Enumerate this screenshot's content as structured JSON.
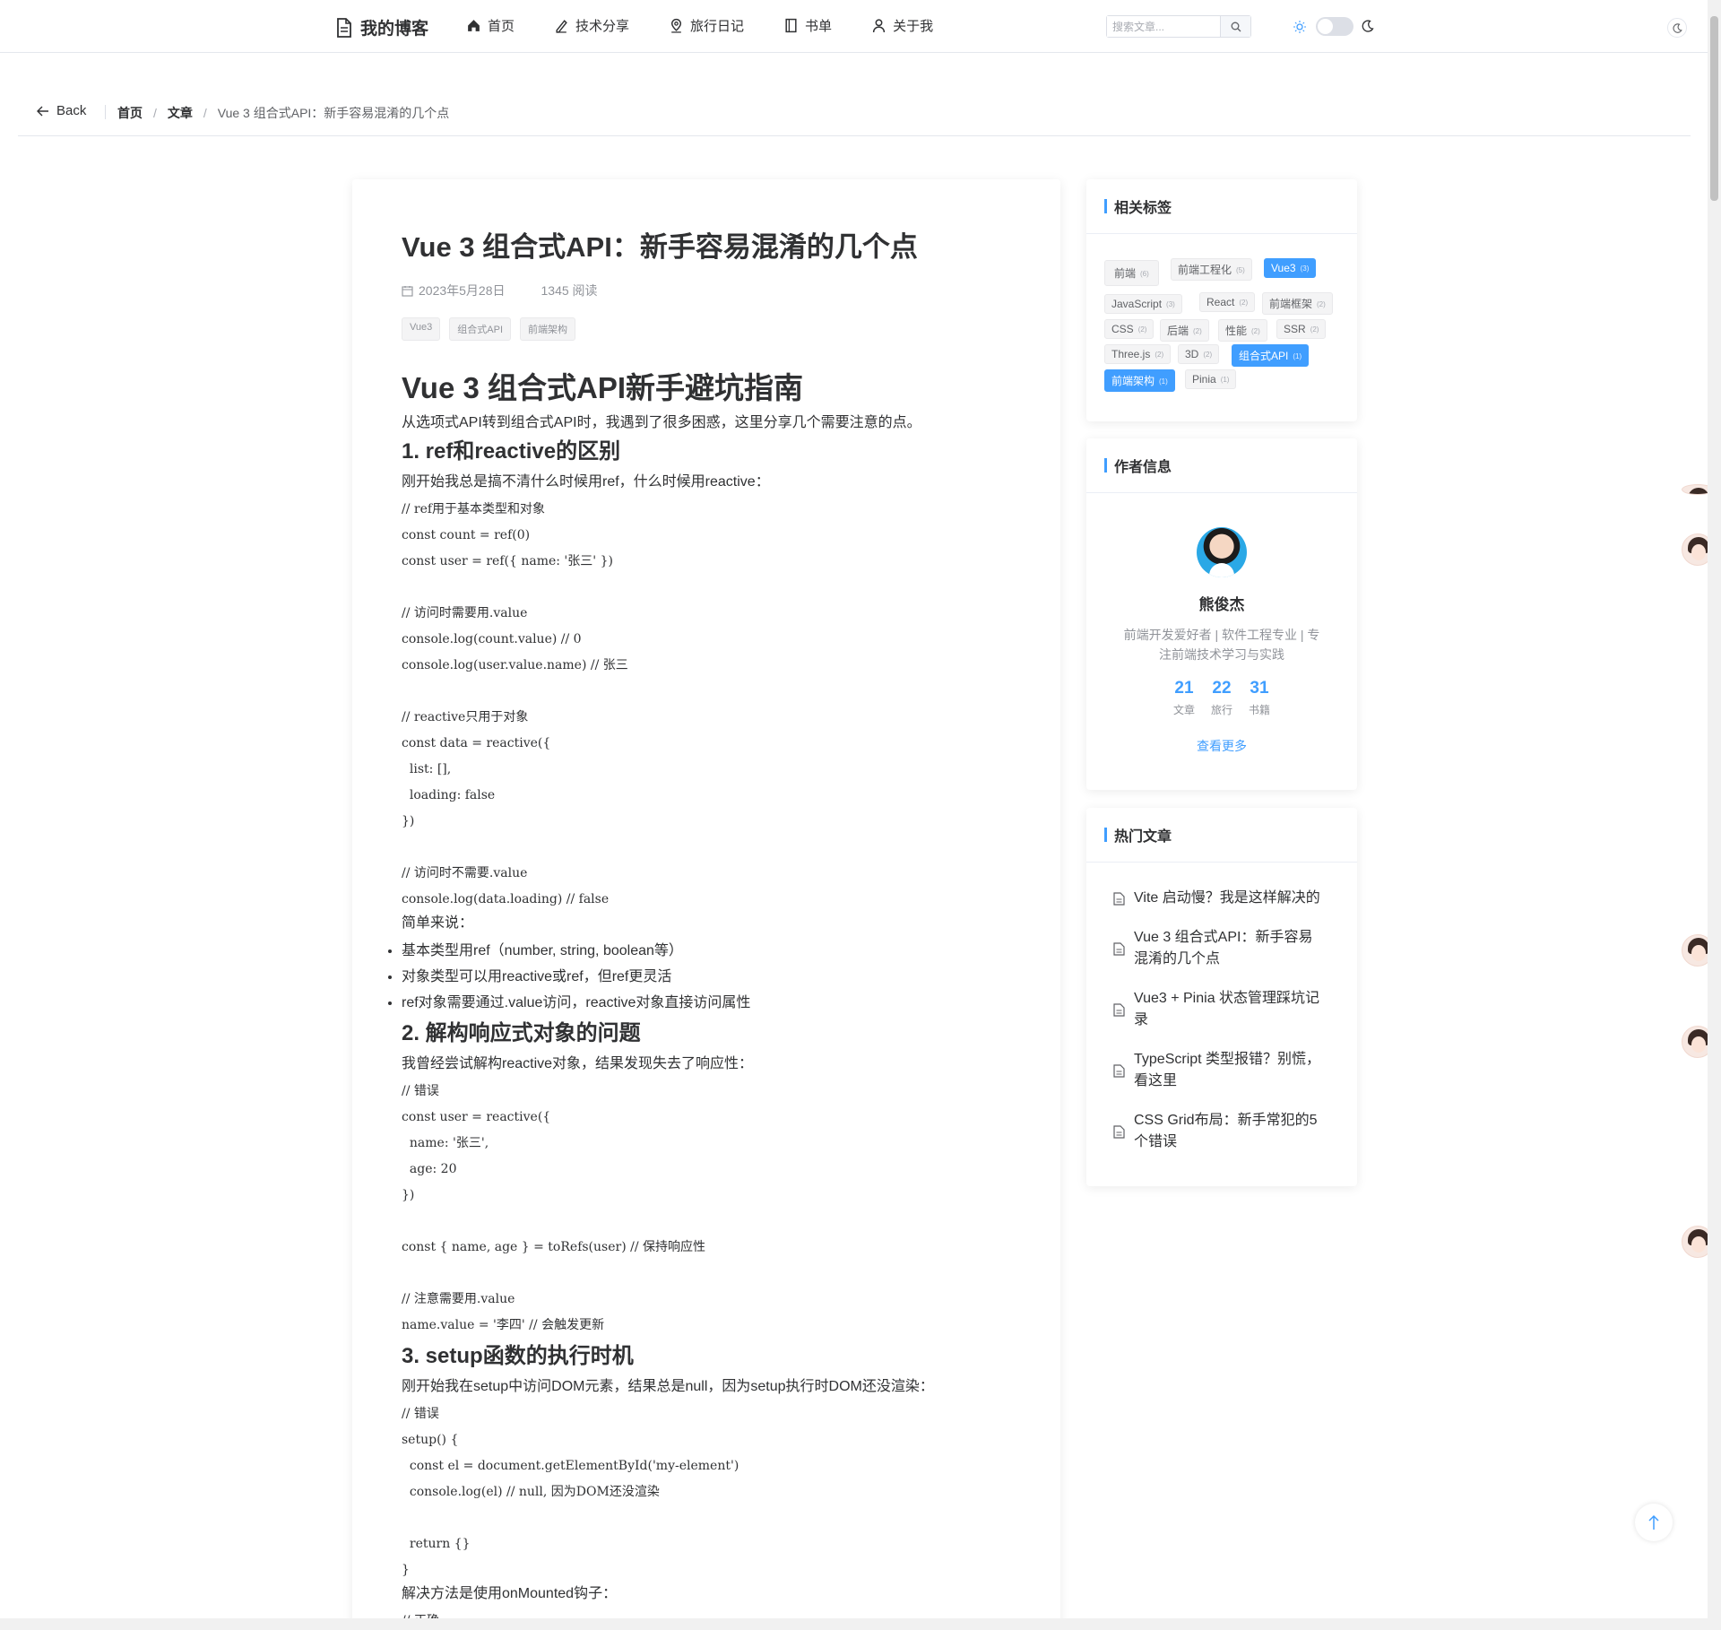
{
  "header": {
    "logo": "我的博客",
    "nav": [
      {
        "label": "首页",
        "icon": "home-icon"
      },
      {
        "label": "技术分享",
        "icon": "pen-icon"
      },
      {
        "label": "旅行日记",
        "icon": "location-icon"
      },
      {
        "label": "书单",
        "icon": "book-icon"
      },
      {
        "label": "关于我",
        "icon": "user-icon"
      }
    ],
    "search_placeholder": "搜索文章..."
  },
  "breadcrumb": {
    "back": "Back",
    "items": [
      "首页",
      "文章",
      "Vue 3 组合式API：新手容易混淆的几个点"
    ]
  },
  "article": {
    "title": "Vue 3 组合式API：新手容易混淆的几个点",
    "date": "2023年5月28日",
    "reads": "1345 阅读",
    "tags": [
      "Vue3",
      "组合式API",
      "前端架构"
    ],
    "h2": "Vue 3 组合式API新手避坑指南",
    "intro": "从选项式API转到组合式API时，我遇到了很多困惑，这里分享几个需要注意的点。",
    "s1_title": "1. ref和reactive的区别",
    "s1_text": "刚开始我总是搞不清什么时候用ref，什么时候用reactive：",
    "s1_code": "// ref用于基本类型和对象\nconst count = ref(0)\nconst user = ref({ name: '张三' })\n\n// 访问时需要用.value\nconsole.log(count.value) // 0\nconsole.log(user.value.name) // 张三\n\n// reactive只用于对象\nconst data = reactive({\n  list: [],\n  loading: false\n})\n\n// 访问时不需要.value\nconsole.log(data.loading) // false",
    "s1_summary": "简单来说：",
    "s1_list": [
      "基本类型用ref（number, string, boolean等）",
      "对象类型可以用reactive或ref，但ref更灵活",
      "ref对象需要通过.value访问，reactive对象直接访问属性"
    ],
    "s2_title": "2. 解构响应式对象的问题",
    "s2_text": "我曾经尝试解构reactive对象，结果发现失去了响应性：",
    "s2_code": "// 错误\nconst user = reactive({\n  name: '张三',\n  age: 20\n})\n\nconst { name, age } = toRefs(user) // 保持响应性\n\n// 注意需要用.value\nname.value = '李四' // 会触发更新",
    "s3_title": "3. setup函数的执行时机",
    "s3_text": "刚开始我在setup中访问DOM元素，结果总是null，因为setup执行时DOM还没渲染：",
    "s3_code": "// 错误\nsetup() {\n  const el = document.getElementById('my-element')\n  console.log(el) // null, 因为DOM还没渲染\n\n  return {}\n}",
    "s3_after": "解决方法是使用onMounted钩子：",
    "s3_next": "// 正确"
  },
  "sidebar": {
    "tags_title": "相关标签",
    "tags": [
      {
        "label": "前端",
        "count": "(6)",
        "active": false
      },
      {
        "label": "前端工程化",
        "count": "(5)",
        "active": false
      },
      {
        "label": "Vue3",
        "count": "(3)",
        "active": true
      },
      {
        "label": "JavaScript",
        "count": "(3)",
        "active": false
      },
      {
        "label": "React",
        "count": "(2)",
        "active": false
      },
      {
        "label": "前端框架",
        "count": "(2)",
        "active": false
      },
      {
        "label": "CSS",
        "count": "(2)",
        "active": false
      },
      {
        "label": "后端",
        "count": "(2)",
        "active": false
      },
      {
        "label": "性能",
        "count": "(2)",
        "active": false
      },
      {
        "label": "SSR",
        "count": "(2)",
        "active": false
      },
      {
        "label": "Three.js",
        "count": "(2)",
        "active": false
      },
      {
        "label": "3D",
        "count": "(2)",
        "active": false
      },
      {
        "label": "组合式API",
        "count": "(1)",
        "active": true
      },
      {
        "label": "前端架构",
        "count": "(1)",
        "active": true
      },
      {
        "label": "Pinia",
        "count": "(1)",
        "active": false
      }
    ],
    "author_title": "作者信息",
    "author": {
      "name": "熊俊杰",
      "bio": "前端开发爱好者 | 软件工程专业 | 专注前端技术学习与实践",
      "stats": [
        {
          "num": "21",
          "label": "文章"
        },
        {
          "num": "22",
          "label": "旅行"
        },
        {
          "num": "31",
          "label": "书籍"
        }
      ],
      "more": "查看更多"
    },
    "hot_title": "热门文章",
    "hot": [
      "Vite 启动慢？我是这样解决的",
      "Vue 3 组合式API：新手容易混淆的几个点",
      "Vue3 + Pinia 状态管理踩坑记录",
      "TypeScript 类型报错？别慌，看这里",
      "CSS Grid布局：新手常犯的5个错误"
    ]
  },
  "colors": {
    "accent": "#409eff",
    "text": "#303133",
    "muted": "#909399"
  }
}
